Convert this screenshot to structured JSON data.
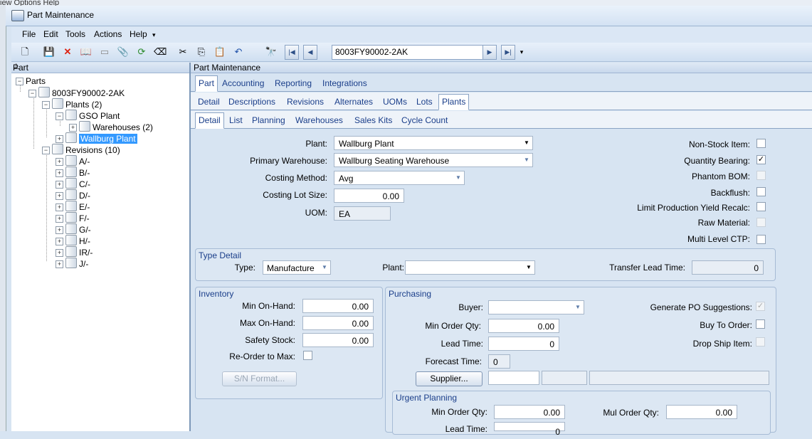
{
  "bg_menu": "iew   Options   Help",
  "window": {
    "title": "Part Maintenance"
  },
  "menu": [
    "File",
    "Edit",
    "Tools",
    "Actions",
    "Help"
  ],
  "toolbar": {
    "part_number": "8003FY90002-2AK"
  },
  "tree": {
    "header": "Part",
    "root": "Parts",
    "part": "8003FY90002-2AK",
    "plants": "Plants (2)",
    "gso_plant": "GSO Plant",
    "warehouses": "Warehouses (2)",
    "wallburg_plant": "Wallburg Plant",
    "revisions": "Revisions (10)",
    "revision_items": [
      "A/-",
      "B/-",
      "C/-",
      "D/-",
      "E/-",
      "F/-",
      "G/-",
      "H/-",
      "IR/-",
      "J/-"
    ]
  },
  "panel_title": "Part Maintenance",
  "tabs_l1": [
    "Part",
    "Accounting",
    "Reporting",
    "Integrations"
  ],
  "tabs_l2": [
    "Detail",
    "Descriptions",
    "Revisions",
    "Alternates",
    "UOMs",
    "Lots",
    "Plants"
  ],
  "tabs_l3": [
    "Detail",
    "List",
    "Planning",
    "Warehouses",
    "Sales Kits",
    "Cycle Count"
  ],
  "form": {
    "plant_label": "Plant:",
    "plant_value": "Wallburg Plant",
    "primary_wh_label": "Primary Warehouse:",
    "primary_wh_value": "Wallburg Seating Warehouse",
    "costing_method_label": "Costing Method:",
    "costing_method_value": "Avg",
    "costing_lot_size_label": "Costing Lot Size:",
    "costing_lot_size_value": "0.00",
    "uom_label": "UOM:",
    "uom_value": "EA",
    "non_stock_label": "Non-Stock Item:",
    "quantity_bearing_label": "Quantity Bearing:",
    "phantom_bom_label": "Phantom BOM:",
    "backflush_label": "Backflush:",
    "limit_prod_label": "Limit Production Yield Recalc:",
    "raw_material_label": "Raw Material:",
    "multi_level_label": "Multi Level CTP:"
  },
  "type_detail": {
    "title": "Type Detail",
    "type_label": "Type:",
    "type_value": "Manufacture",
    "plant_label": "Plant:",
    "transfer_label": "Transfer Lead Time:",
    "transfer_value": "0"
  },
  "inventory": {
    "title": "Inventory",
    "min_label": "Min On-Hand:",
    "min_value": "0.00",
    "max_label": "Max On-Hand:",
    "max_value": "0.00",
    "safety_label": "Safety Stock:",
    "safety_value": "0.00",
    "reorder_label": "Re-Order to Max:",
    "sn_button": "S/N Format..."
  },
  "purchasing": {
    "title": "Purchasing",
    "buyer_label": "Buyer:",
    "min_order_label": "Min Order Qty:",
    "min_order_value": "0.00",
    "lead_time_label": "Lead Time:",
    "lead_time_value": "0",
    "forecast_label": "Forecast Time:",
    "forecast_value": "0",
    "supplier_button": "Supplier...",
    "gen_po_label": "Generate PO Suggestions:",
    "buy_to_order_label": "Buy To Order:",
    "drop_ship_label": "Drop Ship Item:"
  },
  "urgent": {
    "title": "Urgent Planning",
    "min_order_label": "Min Order Qty:",
    "min_order_value": "0.00",
    "mul_order_label": "Mul Order Qty:",
    "mul_order_value": "0.00",
    "lead_time_label": "Lead Time:",
    "lead_time_value": "0"
  }
}
